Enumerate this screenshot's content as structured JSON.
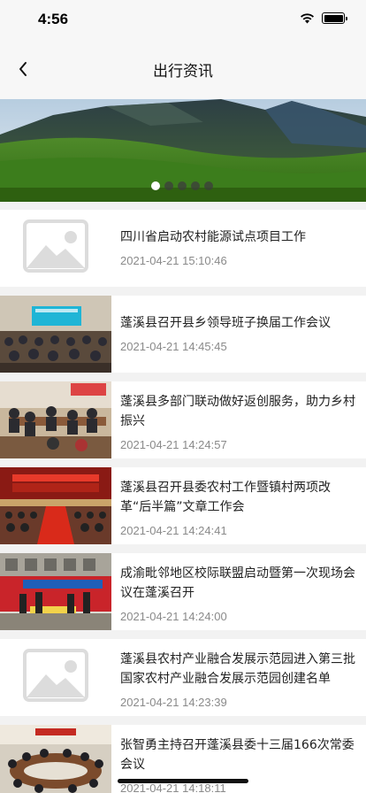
{
  "status": {
    "time": "4:56"
  },
  "nav": {
    "title": "出行资讯"
  },
  "banner": {
    "dot_count": 5,
    "active_index": 0
  },
  "news": [
    {
      "title": "四川省启动农村能源试点项目工作",
      "time": "2021-04-21 15:10:46",
      "thumb": "placeholder-image-icon"
    },
    {
      "title": "蓬溪县召开县乡领导班子换届工作会议",
      "time": "2021-04-21 14:45:45",
      "thumb": "meeting-photo"
    },
    {
      "title": "蓬溪县多部门联动做好返创服务，助力乡村振兴",
      "time": "2021-04-21 14:24:57",
      "thumb": "meeting-photo"
    },
    {
      "title": "蓬溪县召开县委农村工作暨镇村两项改革“后半篇”文章工作会",
      "time": "2021-04-21 14:24:41",
      "thumb": "meeting-photo"
    },
    {
      "title": "成渝毗邻地区校际联盟启动暨第一次现场会议在蓬溪召开",
      "time": "2021-04-21 14:24:00",
      "thumb": "event-photo"
    },
    {
      "title": "蓬溪县农村产业融合发展示范园进入第三批国家农村产业融合发展示范园创建名单",
      "time": "2021-04-21 14:23:39",
      "thumb": "placeholder-image-icon"
    },
    {
      "title": "张智勇主持召开蓬溪县委十三届166次常委会议",
      "time": "2021-04-21 14:18:11",
      "thumb": "meeting-photo"
    }
  ]
}
